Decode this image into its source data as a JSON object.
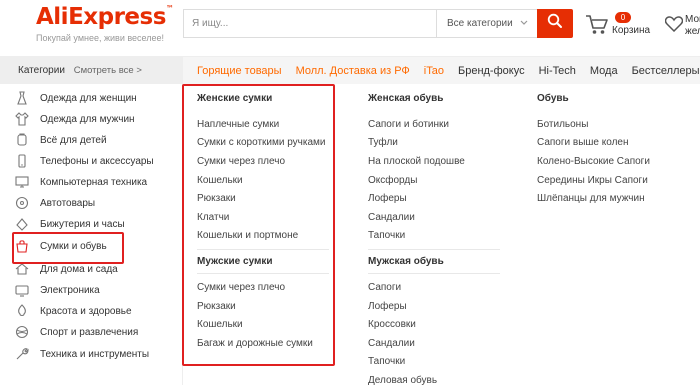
{
  "header": {
    "logo_text": "AliExpress",
    "logo_tm": "™",
    "tagline": "Покупай умнее, живи веселее!",
    "search_placeholder": "Я ищу...",
    "search_category": "Все категории",
    "cart_count": "0",
    "cart_label": "Корзина",
    "wishlist_label": "Мои желания",
    "accent_color": "#e62e04"
  },
  "catbar": {
    "title": "Категории",
    "see_all": "Смотреть все >",
    "nav": [
      {
        "label": "Горящие товары",
        "color": "orange"
      },
      {
        "label": "Молл. Доставка из РФ",
        "color": "orange"
      },
      {
        "label": "iTao",
        "color": "orange"
      },
      {
        "label": "Бренд-фокус",
        "color": "default"
      },
      {
        "label": "Hi-Tech",
        "color": "default"
      },
      {
        "label": "Мода",
        "color": "default"
      },
      {
        "label": "Бестселлеры",
        "color": "default"
      }
    ]
  },
  "sidebar": {
    "items": [
      {
        "label": "Одежда для женщин",
        "icon": "dress-icon"
      },
      {
        "label": "Одежда для мужчин",
        "icon": "shirt-icon"
      },
      {
        "label": "Всё для детей",
        "icon": "baby-icon"
      },
      {
        "label": "Телефоны и аксессуары",
        "icon": "phone-icon"
      },
      {
        "label": "Компьютерная техника",
        "icon": "computer-icon"
      },
      {
        "label": "Автотовары",
        "icon": "car-icon"
      },
      {
        "label": "Бижутерия и часы",
        "icon": "watch-icon"
      },
      {
        "label": "Сумки и обувь",
        "icon": "bag-icon"
      },
      {
        "label": "Для дома и сада",
        "icon": "home-icon"
      },
      {
        "label": "Электроника",
        "icon": "tv-icon"
      },
      {
        "label": "Красота и здоровье",
        "icon": "beauty-icon"
      },
      {
        "label": "Спорт и развлечения",
        "icon": "sport-icon"
      },
      {
        "label": "Техника и инструменты",
        "icon": "tools-icon"
      }
    ]
  },
  "menu": {
    "col1": {
      "group1_title": "Женские сумки",
      "group1_links": [
        "Наплечные сумки",
        "Сумки с короткими ручками",
        "Сумки через плечо",
        "Кошельки",
        "Рюкзаки",
        "Клатчи",
        "Кошельки и портмоне"
      ],
      "group2_title": "Мужские сумки",
      "group2_links": [
        "Сумки через плечо",
        "Рюкзаки",
        "Кошельки",
        "Багаж и дорожные сумки"
      ]
    },
    "col2": {
      "group1_title": "Женская обувь",
      "group1_links": [
        "Сапоги и ботинки",
        "Туфли",
        "На плоской подошве",
        "Оксфорды",
        "Лоферы",
        "Сандалии",
        "Тапочки"
      ],
      "group2_title": "Мужская обувь",
      "group2_links": [
        "Сапоги",
        "Лоферы",
        "Кроссовки",
        "Сандалии",
        "Тапочки",
        "Деловая обувь"
      ]
    },
    "col3": {
      "group1_title": "Обувь",
      "group1_links": [
        "Ботильоны",
        "Сапоги выше колен",
        "Колено-Высокие Сапоги",
        "Середины Икры Сапоги",
        "Шлёпанцы для мужчин"
      ]
    }
  }
}
